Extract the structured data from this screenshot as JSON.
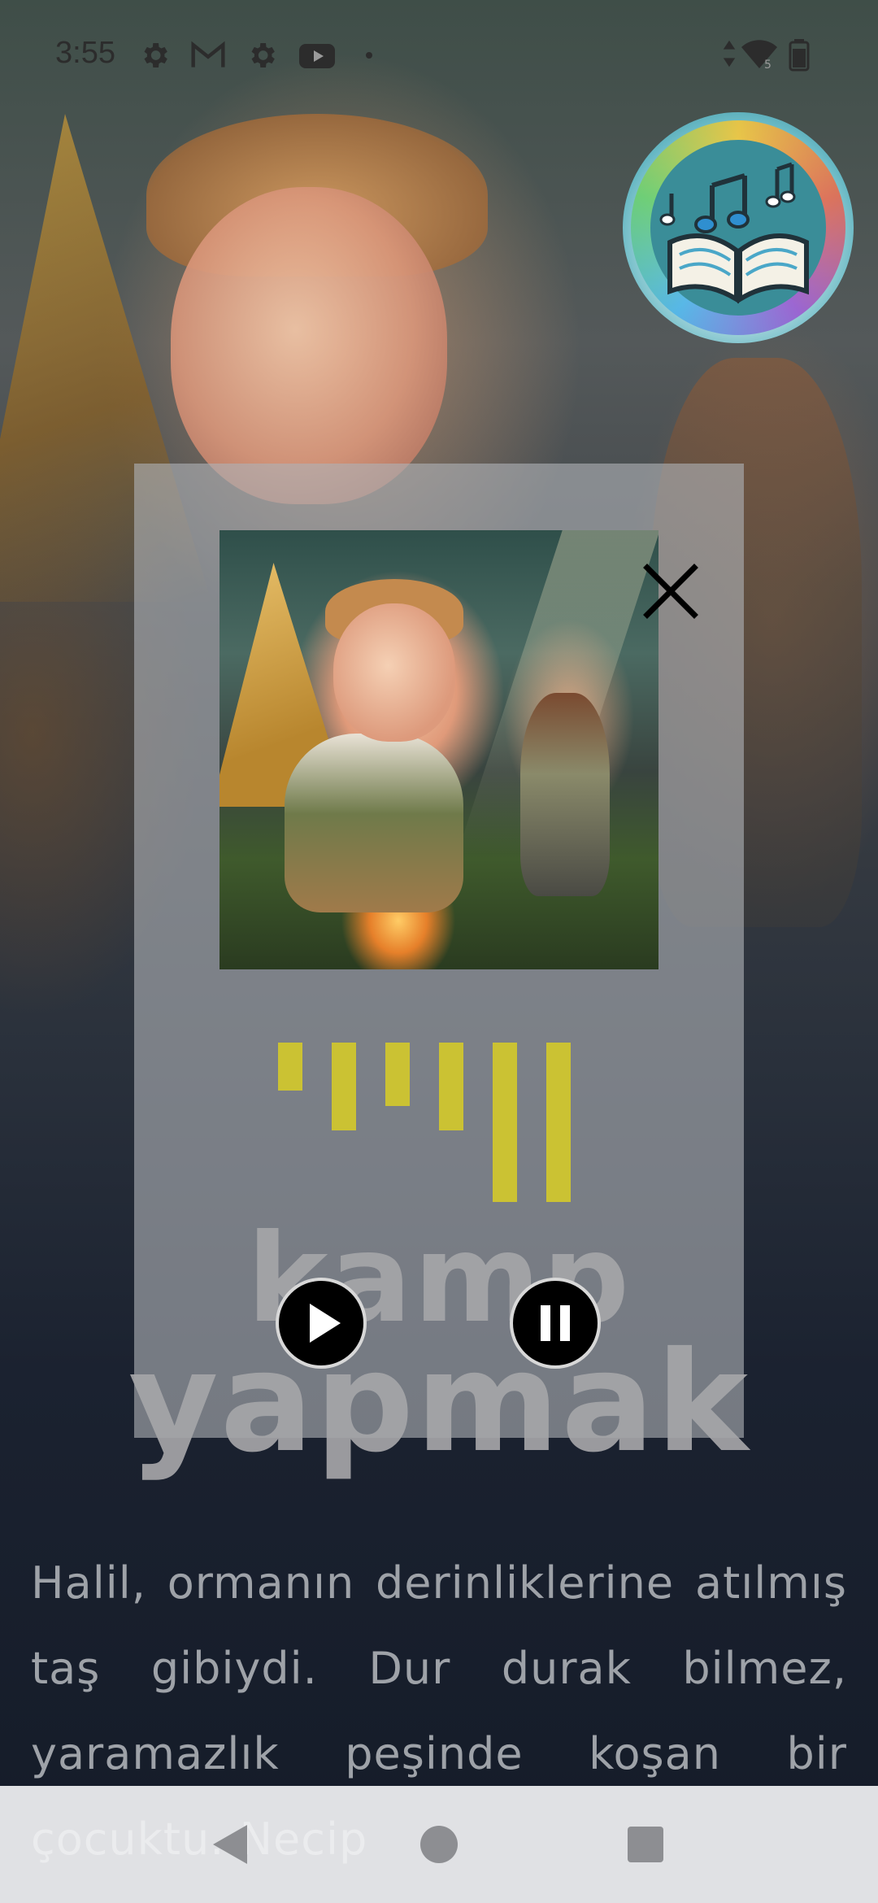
{
  "status_bar": {
    "time": "3:55",
    "left_icons": [
      "settings-icon",
      "gmail-icon",
      "settings-icon",
      "youtube-icon",
      "dot-icon"
    ],
    "right_icons": [
      "data-arrows-icon",
      "wifi-icon",
      "battery-icon"
    ],
    "wifi_badge": "5"
  },
  "logo": {
    "name": "musical-storybook-logo"
  },
  "modal": {
    "title_line1": "kamp",
    "title_line2": "yapmak",
    "close_icon": "close-icon",
    "play_icon": "play-icon",
    "pause_icon": "pause-icon",
    "audio_levels": [
      0.3,
      0.55,
      0.4,
      0.55,
      1.0,
      1.0
    ],
    "accent_color": "#cbc233"
  },
  "story": {
    "text": "Halil, ormanın derinliklerine atılmış taş gibiydi. Dur durak bilmez, yaramazlık peşinde koşan bir çocuktu. Necip"
  },
  "nav_bar": {
    "back_icon": "back-triangle-icon",
    "home_icon": "home-circle-icon",
    "recents_icon": "recents-square-icon"
  }
}
